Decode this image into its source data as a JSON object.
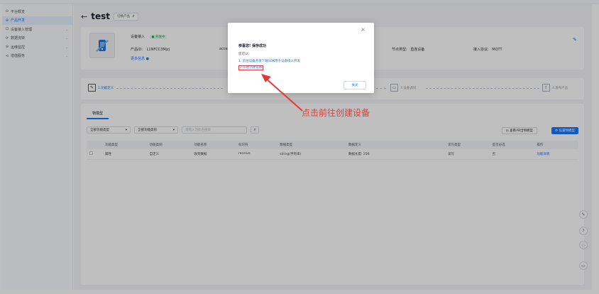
{
  "sidebar": {
    "items": [
      {
        "icon": "⊙",
        "label": "平台概览"
      },
      {
        "icon": "⊕",
        "label": "产品开发"
      },
      {
        "icon": "⊡",
        "label": "设备接入管理"
      },
      {
        "icon": "⟳",
        "label": "数据流转"
      },
      {
        "icon": "⊖",
        "label": "运维监控"
      },
      {
        "icon": "⊲",
        "label": "增值服务"
      }
    ]
  },
  "header": {
    "title": "test",
    "product_select": "切换产品"
  },
  "card": {
    "access_label": "设备接入",
    "status": "开发中",
    "product_id_label": "产品ID:",
    "product_id": "L1NFCC3Mjzj",
    "access_key_label": "access",
    "more_info": "更多信息",
    "node_type_label": "节点类型:",
    "node_type": "直连设备",
    "protocol_label": "接入协议:",
    "protocol": "MQTT"
  },
  "steps": {
    "step1": "1.功能定义",
    "step3": "3.设备调试",
    "step4": "4.发布产品"
  },
  "panel": {
    "tab": "物模型",
    "filter_type": "全部功能类型",
    "filter_category": "全部功能类别",
    "search_placeholder": "请输入功能名搜索",
    "import_export": "查看/导出物模型",
    "set_model": "设置物模型",
    "columns": [
      "功能类型",
      "功能类别",
      "功能名称",
      "标识符",
      "数据类型",
      "数据定义",
      "读写类型",
      "是否必选",
      "操作"
    ],
    "rows": [
      [
        "属性",
        "自定义",
        "收到数据",
        "receive",
        "string(字符串)",
        "数据长度: 256",
        "读写",
        "否",
        "功能详情"
      ]
    ]
  },
  "modal": {
    "title": "恭喜您! 保存成功",
    "subtitle": "您可以:",
    "link1": "1. 前往设备开发下载SDK用于设备接入开发",
    "link2": "2.前往创建设备",
    "ok": "关闭"
  },
  "annotation": "点击前往创建设备",
  "colors": {
    "primary": "#1677ff",
    "annotation": "#e53935",
    "status_green": "#1aa55a"
  }
}
